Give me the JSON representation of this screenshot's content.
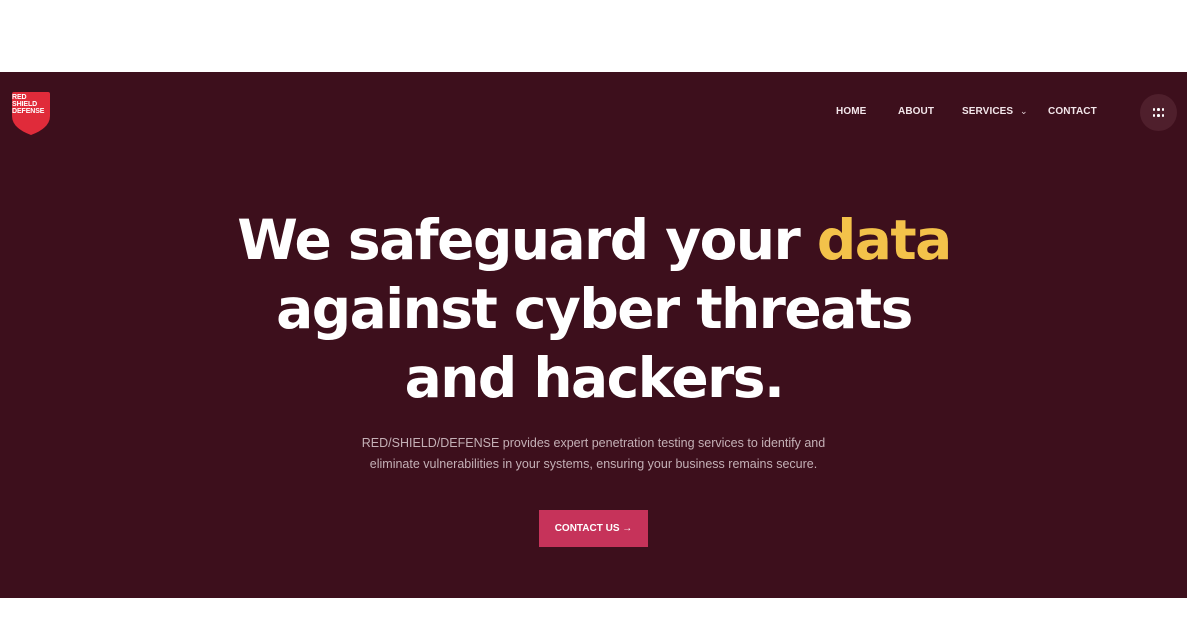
{
  "brand": {
    "logo_lines": [
      "RED",
      "SHIELD",
      "DEFENSE"
    ],
    "colors": {
      "background": "#3d0f1c",
      "accent": "#f3c24a",
      "button": "#c6335a",
      "logo_red": "#e02b3a"
    }
  },
  "nav": {
    "items": [
      {
        "label": "HOME"
      },
      {
        "label": "ABOUT"
      },
      {
        "label": "SERVICES"
      },
      {
        "label": "CONTACT"
      }
    ],
    "services_dropdown_icon": "chevron-down-icon",
    "menu_icon": "grid-dots-icon"
  },
  "hero": {
    "headline": {
      "line1_prefix": "We safeguard your",
      "line1_accent": "data",
      "line2": "against cyber threats",
      "line3": "and hackers."
    },
    "subtext": {
      "line1": "RED/SHIELD/DEFENSE provides expert penetration testing services to identify and",
      "line2": "eliminate vulnerabilities in your systems, ensuring your business remains secure."
    },
    "cta": {
      "label": "CONTACT US →"
    }
  }
}
